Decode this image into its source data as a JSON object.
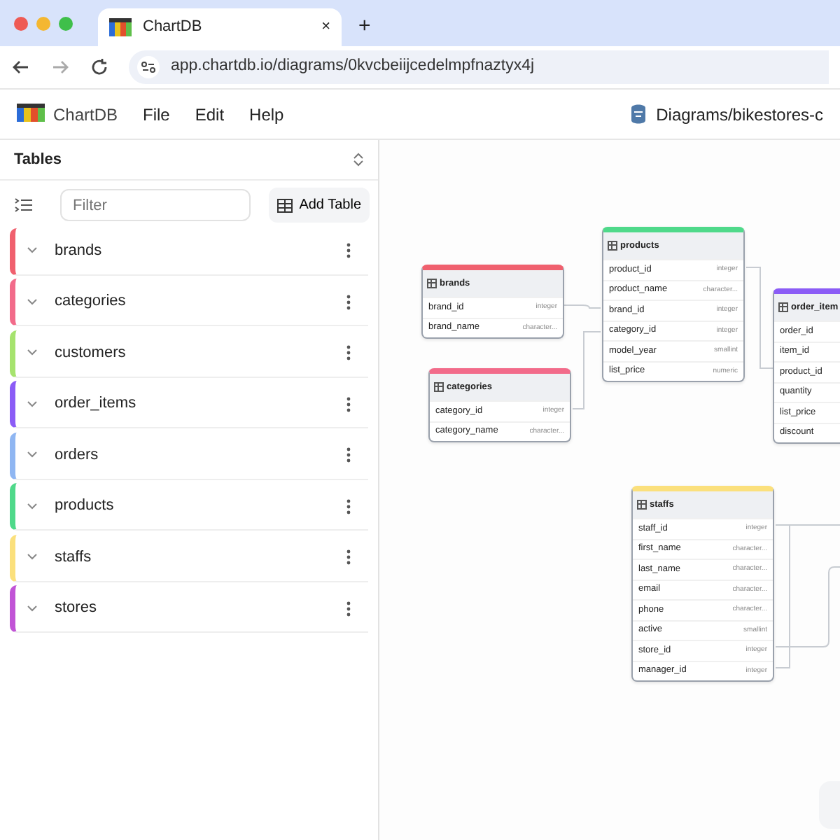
{
  "browser": {
    "tab_title": "ChartDB",
    "tab_close": "×",
    "new_tab": "+",
    "url": "app.chartdb.io/diagrams/0kvcbeiijcedelmpfnaztyx4j"
  },
  "app": {
    "name": "ChartDB",
    "menu": [
      "File",
      "Edit",
      "Help"
    ],
    "diagram_path": "Diagrams/bikestores-c"
  },
  "sidebar": {
    "title": "Tables",
    "filter_placeholder": "Filter",
    "add_button": "Add Table",
    "tables": [
      {
        "name": "brands",
        "color": "#f0606e"
      },
      {
        "name": "categories",
        "color": "#f26b8a"
      },
      {
        "name": "customers",
        "color": "#a6e36e"
      },
      {
        "name": "order_items",
        "color": "#8b5cf6"
      },
      {
        "name": "orders",
        "color": "#8fb6f2"
      },
      {
        "name": "products",
        "color": "#4fd98a"
      },
      {
        "name": "staffs",
        "color": "#fbe07c"
      },
      {
        "name": "stores",
        "color": "#c154d6"
      }
    ]
  },
  "canvas": {
    "nodes": [
      {
        "name": "brands",
        "color": "#f0606e",
        "fields": [
          {
            "name": "brand_id",
            "type": "integer"
          },
          {
            "name": "brand_name",
            "type": "character..."
          }
        ]
      },
      {
        "name": "categories",
        "color": "#f26b8a",
        "fields": [
          {
            "name": "category_id",
            "type": "integer"
          },
          {
            "name": "category_name",
            "type": "character..."
          }
        ]
      },
      {
        "name": "products",
        "color": "#4fd98a",
        "fields": [
          {
            "name": "product_id",
            "type": "integer"
          },
          {
            "name": "product_name",
            "type": "character..."
          },
          {
            "name": "brand_id",
            "type": "integer"
          },
          {
            "name": "category_id",
            "type": "integer"
          },
          {
            "name": "model_year",
            "type": "smallint"
          },
          {
            "name": "list_price",
            "type": "numeric"
          }
        ]
      },
      {
        "name": "order_item",
        "color": "#8b5cf6",
        "fields": [
          {
            "name": "order_id"
          },
          {
            "name": "item_id"
          },
          {
            "name": "product_id"
          },
          {
            "name": "quantity"
          },
          {
            "name": "list_price"
          },
          {
            "name": "discount"
          }
        ]
      },
      {
        "name": "staffs",
        "color": "#fbe07c",
        "fields": [
          {
            "name": "staff_id",
            "type": "integer"
          },
          {
            "name": "first_name",
            "type": "character..."
          },
          {
            "name": "last_name",
            "type": "character..."
          },
          {
            "name": "email",
            "type": "character..."
          },
          {
            "name": "phone",
            "type": "character..."
          },
          {
            "name": "active",
            "type": "smallint"
          },
          {
            "name": "store_id",
            "type": "integer"
          },
          {
            "name": "manager_id",
            "type": "integer"
          }
        ]
      }
    ]
  }
}
